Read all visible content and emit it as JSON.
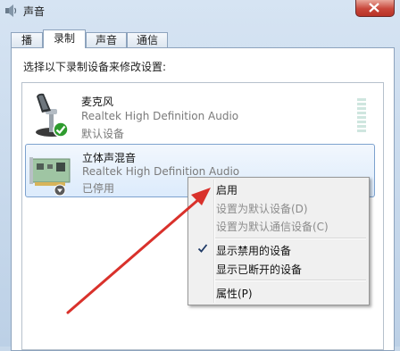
{
  "window": {
    "title": "声音"
  },
  "tabs": [
    {
      "label": "播放"
    },
    {
      "label": "录制"
    },
    {
      "label": "声音"
    },
    {
      "label": "通信"
    }
  ],
  "panel": {
    "instruction": "选择以下录制设备来修改设置:"
  },
  "devices": [
    {
      "name": "麦克风",
      "description": "Realtek High Definition Audio",
      "status": "默认设备",
      "icon": "microphone-icon",
      "badge": "green-check-icon"
    },
    {
      "name": "立体声混音",
      "description": "Realtek High Definition Audio",
      "status": "已停用",
      "icon": "sound-card-icon",
      "badge": "disabled-down-arrow-icon"
    }
  ],
  "context_menu": {
    "items": [
      {
        "label": "启用",
        "enabled": true
      },
      {
        "label": "设置为默认设备(D)",
        "enabled": false
      },
      {
        "label": "设置为默认通信设备(C)",
        "enabled": false
      },
      {
        "label": "显示禁用的设备",
        "enabled": true,
        "checked": true
      },
      {
        "label": "显示已断开的设备",
        "enabled": true
      },
      {
        "label": "属性(P)",
        "enabled": true
      }
    ]
  },
  "colors": {
    "annotation_arrow": "#d9312b",
    "selection_border": "#7da2ce",
    "check_green": "#2e9b2e"
  }
}
